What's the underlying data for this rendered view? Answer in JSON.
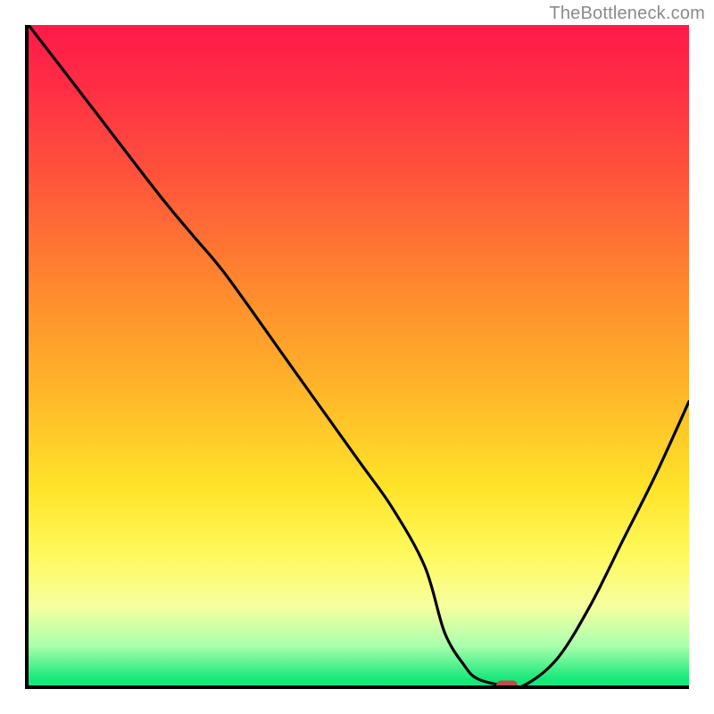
{
  "watermark": "TheBottleneck.com",
  "colors": {
    "curve": "#000000",
    "marker": "#c24a4a",
    "gradient_top": "#ff1a48",
    "gradient_bottom": "#17e87a"
  },
  "chart_data": {
    "type": "line",
    "title": "",
    "xlabel": "",
    "ylabel": "",
    "xlim": [
      0,
      100
    ],
    "ylim": [
      0,
      100
    ],
    "x": [
      0,
      10,
      20,
      25,
      30,
      40,
      50,
      55,
      60,
      63,
      66,
      68,
      72,
      75,
      80,
      85,
      90,
      95,
      100
    ],
    "y": [
      100,
      87,
      74,
      68,
      62,
      48,
      34,
      27,
      18,
      8,
      3,
      1,
      0,
      0,
      4,
      12,
      22,
      32,
      43
    ],
    "min_x": 72,
    "min_y": 0
  }
}
